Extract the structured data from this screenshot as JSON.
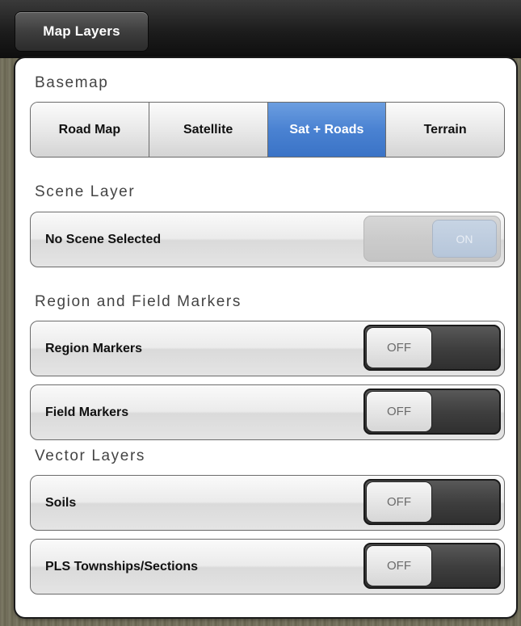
{
  "header": {
    "tab_label": "Map Layers"
  },
  "colors": {
    "accent": "#4a82d2",
    "panel_bg": "#ffffff",
    "toolbar_bg": "#1c1c1c"
  },
  "basemap": {
    "title": "Basemap",
    "options": [
      "Road Map",
      "Satellite",
      "Sat + Roads",
      "Terrain"
    ],
    "selected": "Sat + Roads"
  },
  "scene_layer": {
    "title": "Scene Layer",
    "row_label": "No Scene Selected",
    "toggle_label": "ON",
    "toggle_enabled": false
  },
  "region_field_markers": {
    "title": "Region and Field Markers",
    "rows": [
      {
        "label": "Region Markers",
        "toggle_label": "OFF",
        "on": false
      },
      {
        "label": "Field Markers",
        "toggle_label": "OFF",
        "on": false
      }
    ]
  },
  "vector_layers": {
    "title": "Vector Layers",
    "rows": [
      {
        "label": "Soils",
        "toggle_label": "OFF",
        "on": false
      },
      {
        "label": "PLS Townships/Sections",
        "toggle_label": "OFF",
        "on": false
      }
    ]
  }
}
